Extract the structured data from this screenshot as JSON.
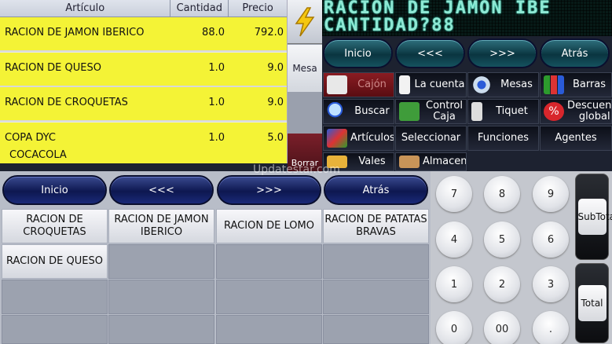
{
  "order": {
    "headers": {
      "article": "Artículo",
      "quantity": "Cantidad",
      "price": "Precio"
    },
    "rows": [
      {
        "article": "RACION DE JAMON IBERICO",
        "quantity": "88.0",
        "price": "792.0",
        "sub": ""
      },
      {
        "article": "RACION DE QUESO",
        "quantity": "1.0",
        "price": "9.0",
        "sub": ""
      },
      {
        "article": "RACION DE CROQUETAS",
        "quantity": "1.0",
        "price": "9.0",
        "sub": ""
      },
      {
        "article": "COPA DYC",
        "quantity": "1.0",
        "price": "5.0",
        "sub": "COCACOLA"
      }
    ]
  },
  "side": {
    "mesa_label": "Mesa",
    "erase_label": "Borrar"
  },
  "display": {
    "line1": "RACION DE JAMON IBE",
    "line2": "CANTIDAD?88"
  },
  "top_nav": {
    "start": "Inicio",
    "prev": "<<<",
    "next": ">>>",
    "back": "Atrás"
  },
  "functions": {
    "cajon": "Cajón",
    "cuenta": "La cuenta",
    "mesas": "Mesas",
    "barras": "Barras",
    "buscar": "Buscar",
    "control_caja": "Control Caja",
    "tiquet": "Tiquet",
    "descuento": "Descuento global",
    "articulos": "Artículos",
    "seleccionar": "Seleccionar",
    "funciones": "Funciones",
    "agentes": "Agentes",
    "vales": "Vales",
    "almacen": "Almacen"
  },
  "bottom_nav": {
    "start": "Inicio",
    "prev": "<<<",
    "next": ">>>",
    "back": "Atrás"
  },
  "products": [
    "RACION DE CROQUETAS",
    "RACION DE JAMON IBERICO",
    "RACION DE LOMO",
    "RACION DE PATATAS BRAVAS",
    "RACION DE QUESO"
  ],
  "numpad": {
    "keys": [
      "7",
      "8",
      "9",
      "4",
      "5",
      "6",
      "1",
      "2",
      "3",
      "0",
      "00",
      "."
    ],
    "subtotal": "SubTotal",
    "total": "Total"
  },
  "watermark": "Updatestar.com",
  "colors": {
    "order_row": "#f4f336",
    "led_text": "#8fe8d4",
    "pill": "#0d1750"
  }
}
